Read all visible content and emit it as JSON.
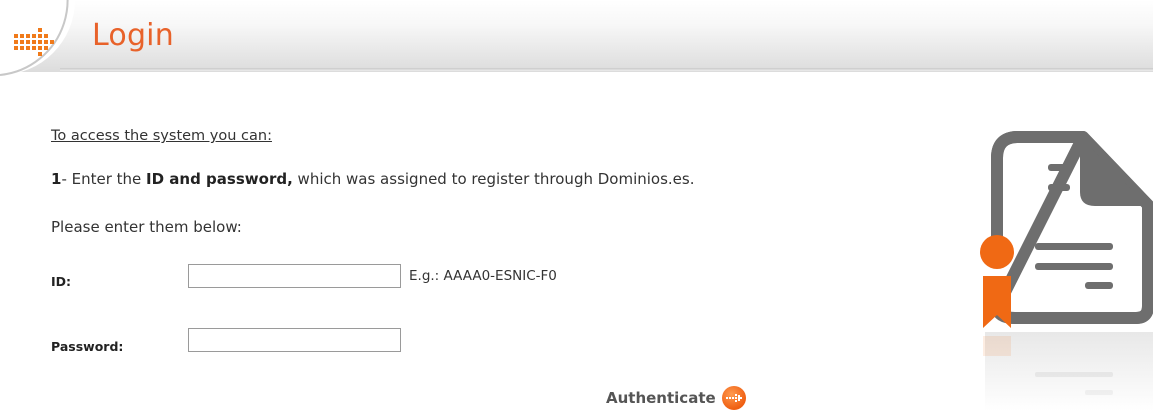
{
  "header": {
    "title": "Login",
    "logo_icon": "dotted-arrow-icon"
  },
  "content": {
    "intro": "To access the system you can:",
    "step_number": "1",
    "step_sep": "- Enter the ",
    "step_bold": "ID and password,",
    "step_rest": " which was assigned to register through Dominios.es.",
    "enter_below": "Please enter them below:"
  },
  "form": {
    "id_label": "ID:",
    "id_value": "",
    "id_hint": "E.g.: AAAA0-ESNIC-F0",
    "password_label": "Password:",
    "password_value": ""
  },
  "actions": {
    "authenticate_label": "Authenticate",
    "authenticate_icon": "arrow-circle-icon"
  },
  "illustration": {
    "icon": "certificate-document-icon"
  },
  "colors": {
    "accent": "#e8622a",
    "text": "#333333",
    "doc_gray": "#6e6e6e"
  }
}
